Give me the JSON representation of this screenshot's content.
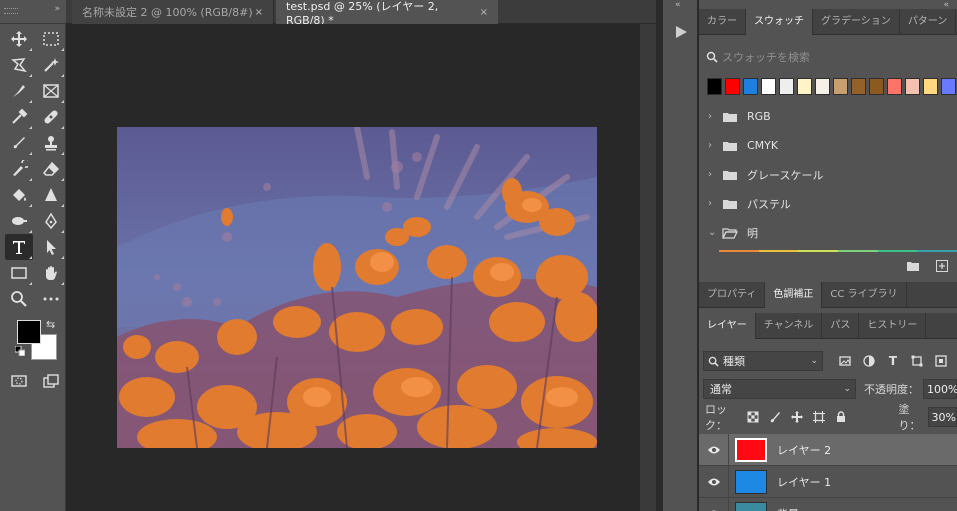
{
  "tabs": [
    {
      "title": "名称未設定 2 @ 100% (RGB/8#)",
      "close": "×"
    },
    {
      "title": "test.psd @ 25% (レイヤー 2, RGB/8) *",
      "close": "×"
    }
  ],
  "swatch_panel": {
    "tabs": [
      "カラー",
      "スウォッチ",
      "グラデーション",
      "パターン"
    ],
    "search_placeholder": "スウォッチを検索",
    "swatches": [
      "#000000",
      "#ff0000",
      "#1e7fe0",
      "#ffffff",
      "#eeeeee",
      "#fff3c8",
      "#f5f0e8",
      "#c8a070",
      "#96602a",
      "#8a5a20",
      "#ff7468",
      "#f4c0b0",
      "#ffd880",
      "#6a7aff"
    ],
    "groups": [
      "RGB",
      "CMYK",
      "グレースケール",
      "パステル",
      "明"
    ]
  },
  "adjust_tabs": [
    "プロパティ",
    "色調補正",
    "CC ライブラリ"
  ],
  "layers_tabs": [
    "レイヤー",
    "チャンネル",
    "パス",
    "ヒストリー"
  ],
  "layers_panel": {
    "kind_label": "種類",
    "blend_mode": "通常",
    "opacity_label": "不透明度：",
    "opacity": "100%",
    "lock_label": "ロック：",
    "fill_label": "塗り：",
    "fill": "30%",
    "layers": [
      {
        "name": "レイヤー 2",
        "color": "#ff0a14",
        "selected": true
      },
      {
        "name": "レイヤー 1",
        "color": "#1e88e5",
        "selected": false
      },
      {
        "name": "背景",
        "color": "#3a8aa0",
        "selected": false
      }
    ]
  },
  "colors": {
    "foreground": "#000000",
    "background": "#ffffff"
  }
}
